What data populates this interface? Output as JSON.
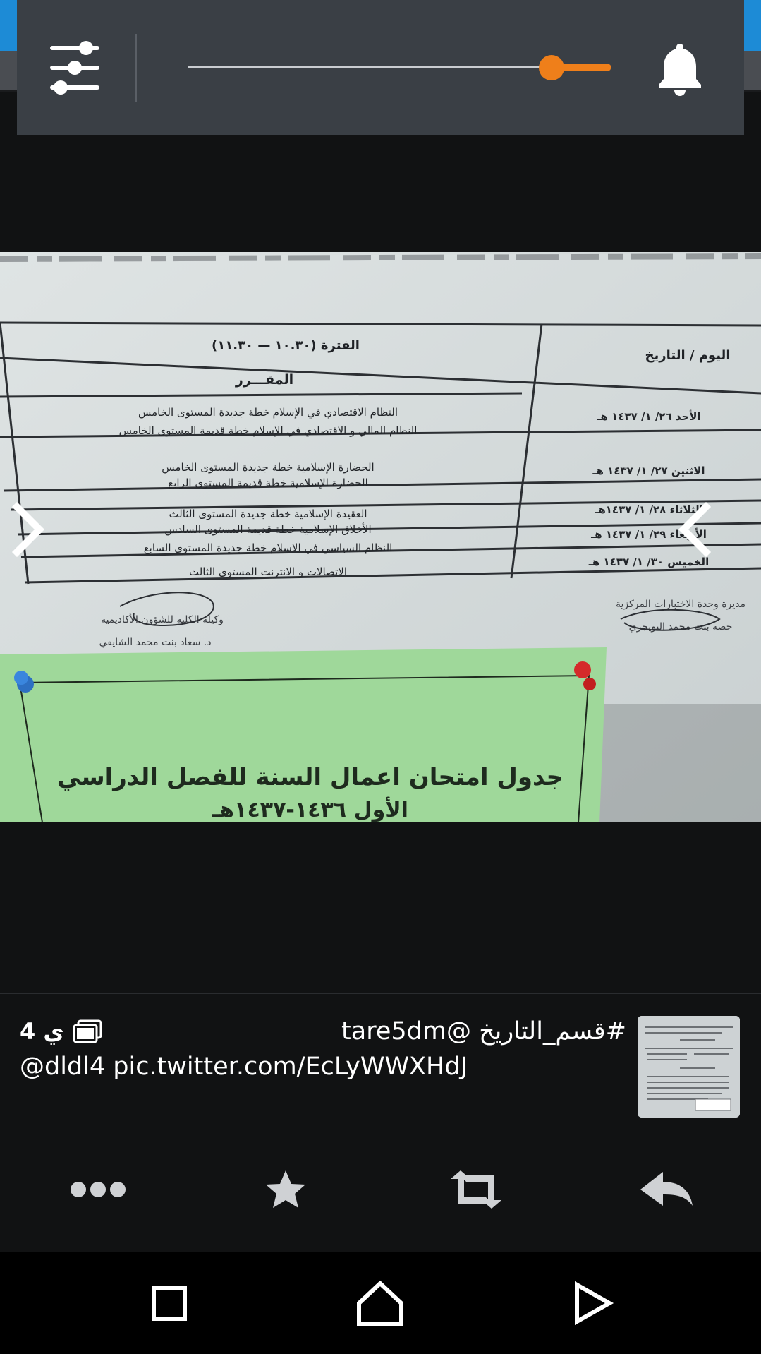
{
  "volume_panel": {
    "settings_icon": "sliders-icon",
    "level": 0.86,
    "accent_color": "#ef7f1a",
    "bell_icon": "bell-icon"
  },
  "photo": {
    "table_header_period": "الفترة (١٠.٣٠ — ١١.٣٠)",
    "table_header_day": "اليوم / التاريخ",
    "table_header_course": "المقـــرر",
    "rows": [
      {
        "date": "الأحد ٢٦/ ١/ ١٤٣٧ هـ",
        "course_1": "النظام الاقتصادي في الإسلام خطة جديدة المستوى الخامس",
        "course_2": "النظام المالي و الاقتصادي في الإسلام خطة قديمة المستوى الخامس"
      },
      {
        "date": "الاثنين ٢٧/ ١/ ١٤٣٧ هـ",
        "course_1": "الحضارة الإسلامية خطة جديدة المستوى الخامس",
        "course_2": "الحضارة الإسلامية خطة قديمة المستوى الرابع"
      },
      {
        "date": "الثلاثاء ٢٨/ ١/ ١٤٣٧هـ",
        "course_1": "العقيدة الإسلامية خطة جديدة المستوى الثالث",
        "course_2": "الأخلاق الإسلامية خطة قديمة المستوى السادس"
      },
      {
        "date": "الأربعاء ٢٩/ ١/ ١٤٣٧ هـ",
        "course_1": "النظام السياسي في الاسلام خطة جديدة المستوى السابع",
        "course_2": ""
      },
      {
        "date": "الخميس ٣٠/ ١/ ١٤٣٧ هـ",
        "course_1": "الاتصالات و الانترنت المستوى الثالث",
        "course_2": ""
      }
    ],
    "sign_left_1": "وكيلة الكلية للشؤون الأكاديمية",
    "sign_left_2": "د. سعاد بنت محمد الشايقي",
    "sign_right_1": "مديرة وحدة الاختبارات المركزية",
    "sign_right_2": "حصة بنت محمد التويجري",
    "green_sign_1": "جدول امتحان اعمال السنة للفصل الدراسي",
    "green_sign_2": "الأول ١٤٣٦-١٤٣٧هـ"
  },
  "tweet": {
    "hashtag_line": "#قسم_التاريخ @tare5dm",
    "body_line": "@dldl4 pic.twitter.com/EcLyWWXHdJ",
    "age": "4 ي",
    "gallery_icon": "gallery-icon"
  },
  "actions": {
    "more": "more-icon",
    "favorite": "star-icon",
    "retweet": "retweet-icon",
    "reply": "reply-icon"
  },
  "navbar": {
    "recents": "recents-icon",
    "home": "home-icon",
    "back": "back-icon"
  }
}
